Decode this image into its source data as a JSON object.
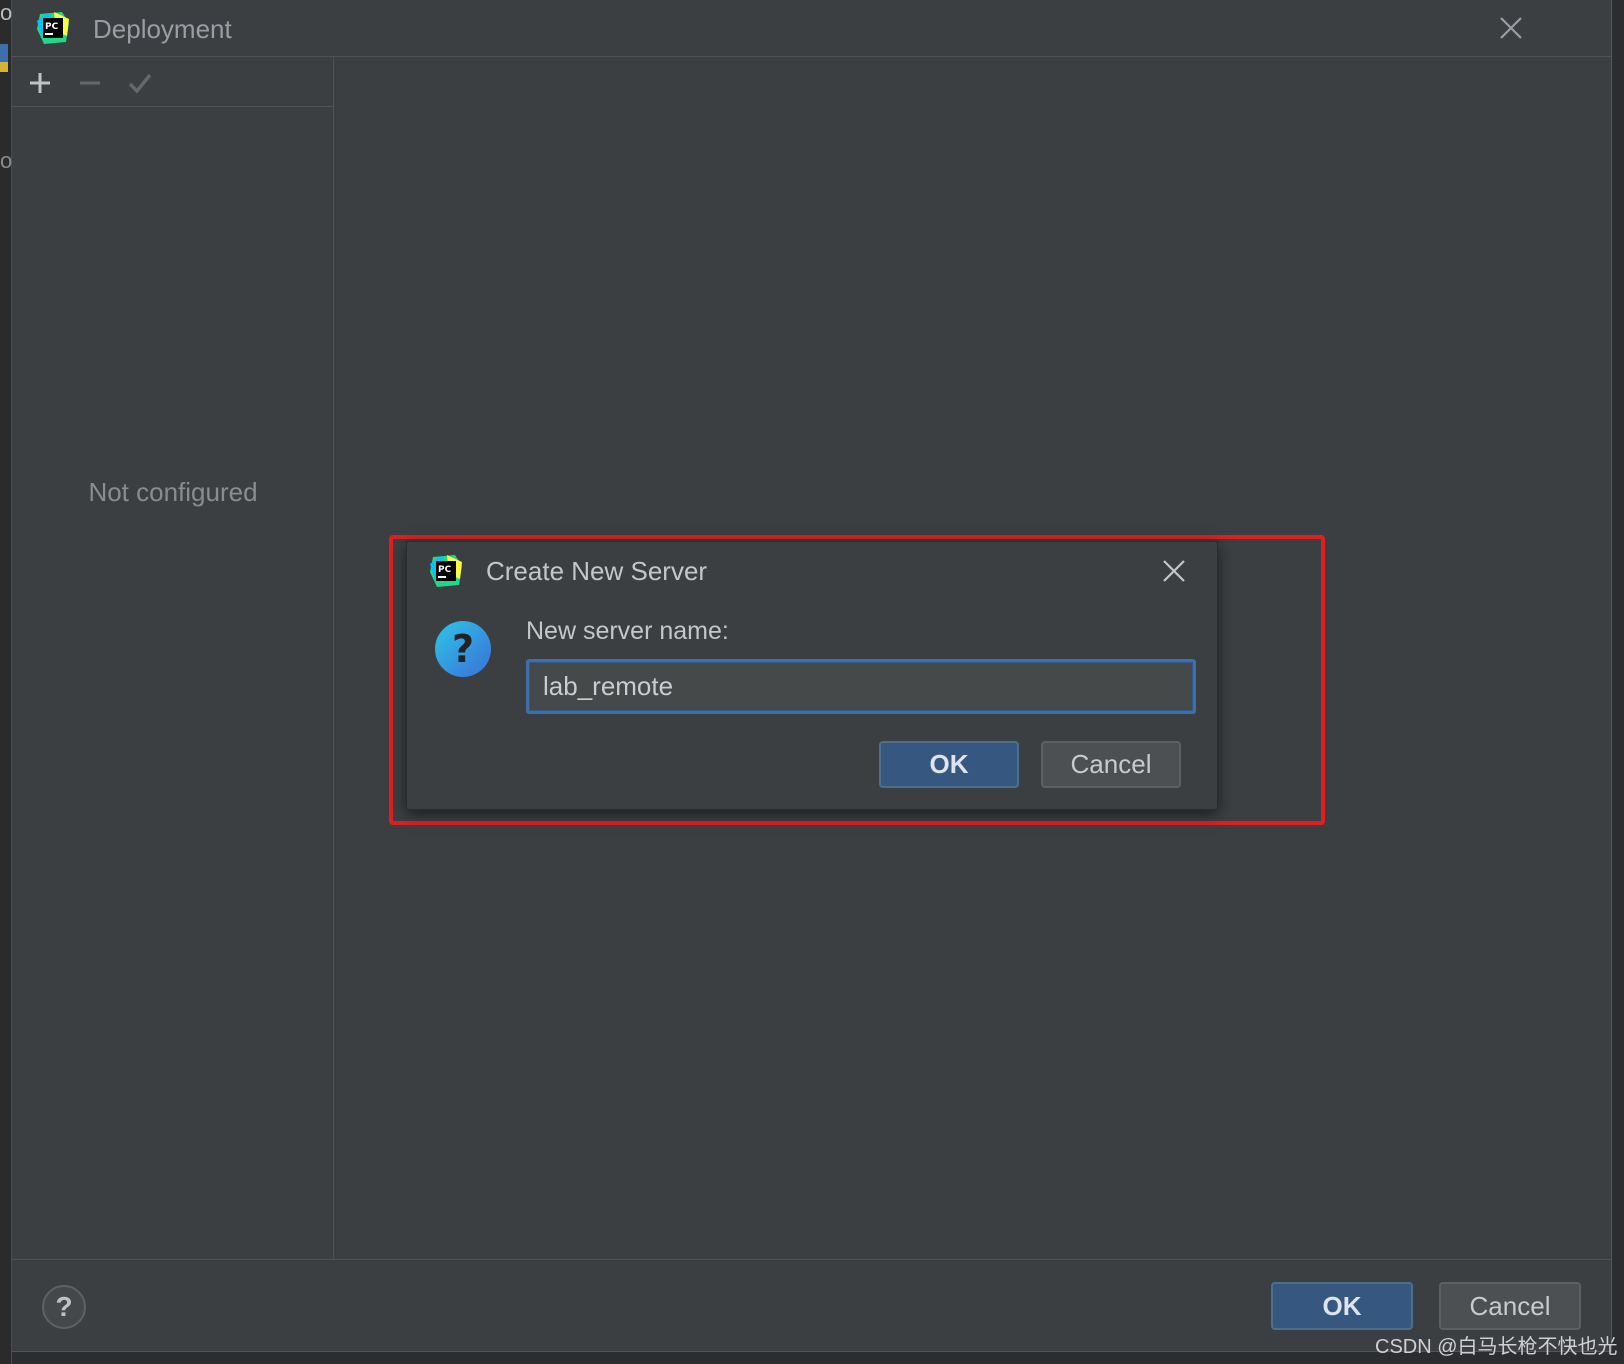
{
  "window": {
    "title": "Deployment",
    "logo_text": "PC"
  },
  "left_panel": {
    "toolbar": {
      "add_icon": "plus-icon",
      "remove_icon": "minus-icon",
      "apply_icon": "check-icon"
    },
    "empty_text": "Not configured"
  },
  "footer": {
    "help_label": "?",
    "ok_label": "OK",
    "cancel_label": "Cancel"
  },
  "dialog": {
    "title": "Create New Server",
    "prompt_label": "New server name:",
    "input_value": "lab_remote",
    "ok_label": "OK",
    "cancel_label": "Cancel",
    "icon": "question-icon",
    "highlight_color": "#e02020"
  },
  "background": {
    "fragment_top": "of",
    "fragment_mid": "o"
  },
  "watermark": "CSDN @白马长枪不快也光",
  "colors": {
    "window_bg": "#3c3f41",
    "primary_button": "#365880",
    "input_border": "#3f6fa8"
  }
}
